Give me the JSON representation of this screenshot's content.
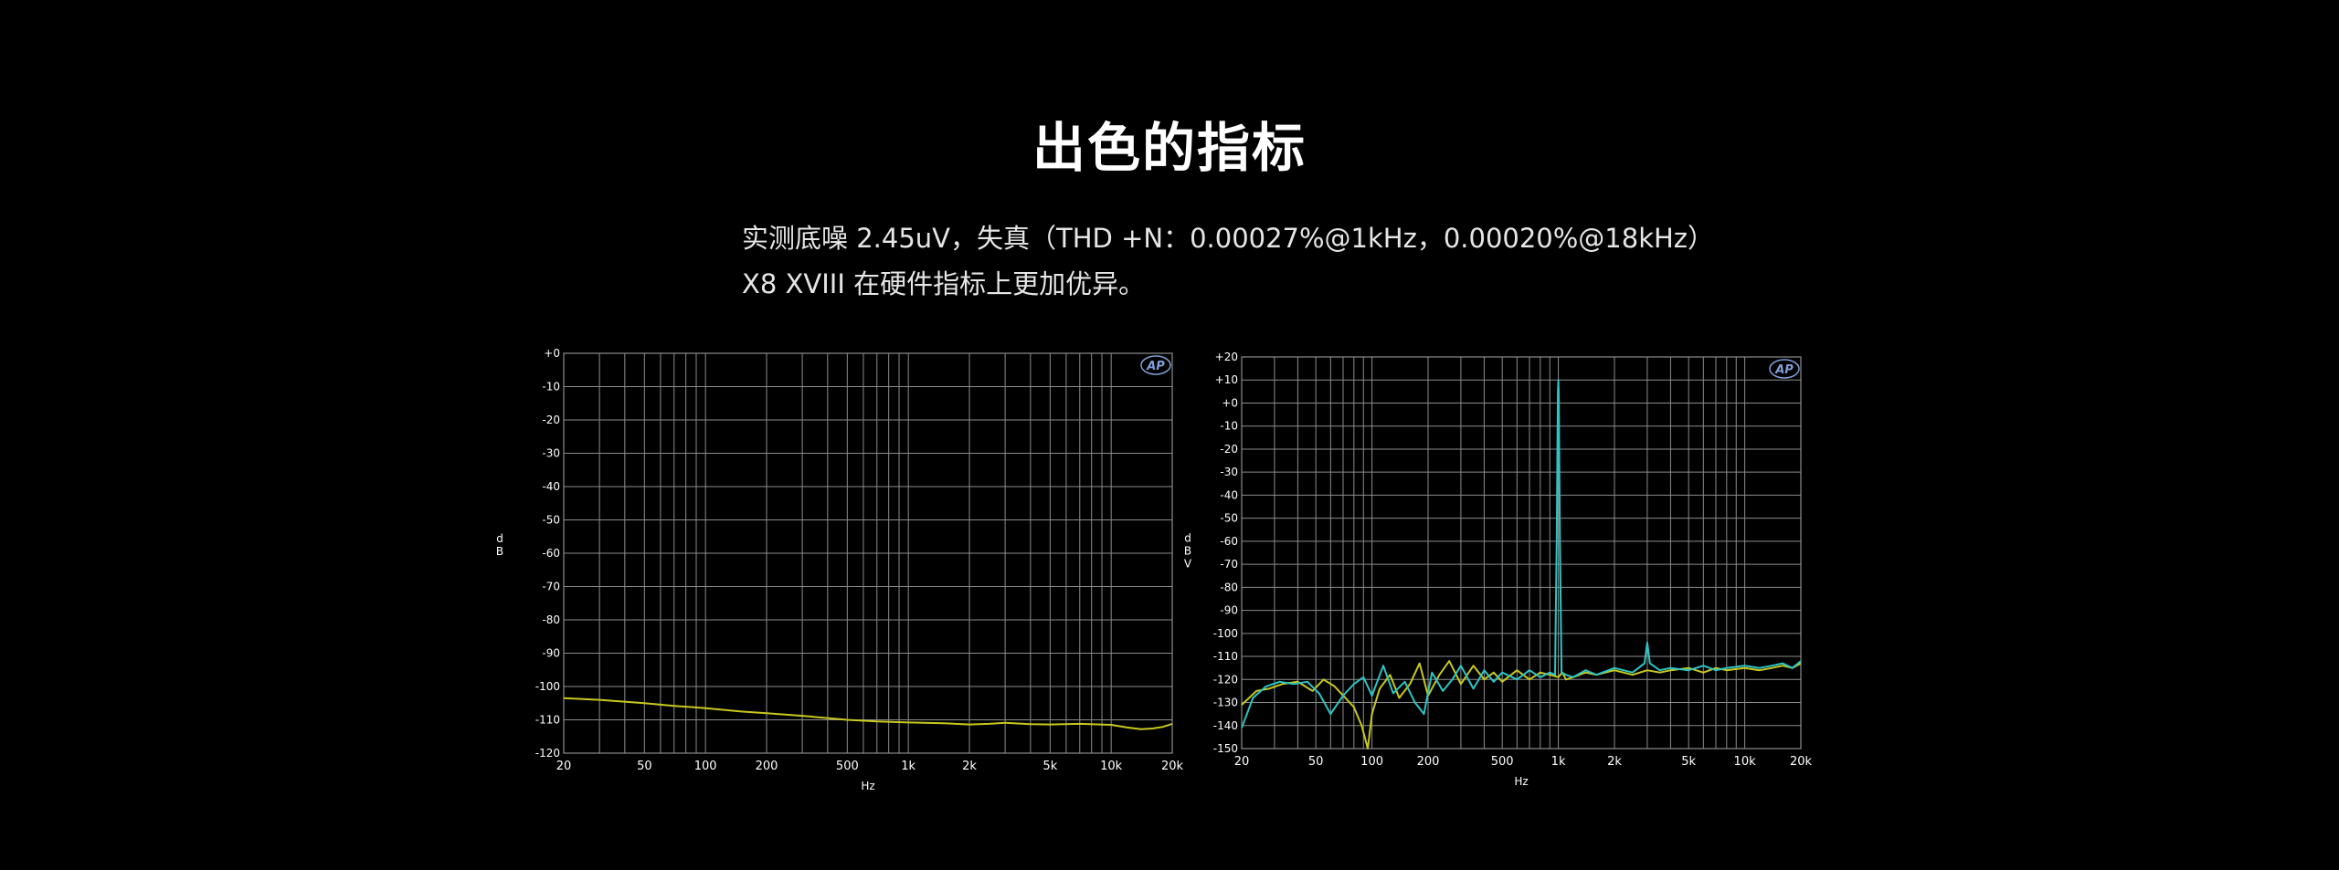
{
  "title": "出色的指标",
  "description": {
    "line1": "实测底噪 2.45uV，失真（THD +N：0.00027%@1kHz，0.00020%@18kHz）",
    "line2": "X8 XVIII 在硬件指标上更加优异。"
  },
  "colors": {
    "background": "#000000",
    "grid": "#8c8c8c",
    "yellow_trace": "#c8c81e",
    "cyan_trace": "#2ec4c4",
    "logo": "#7f9fd6"
  },
  "chart_data": [
    {
      "type": "line",
      "title": "",
      "xlabel": "Hz",
      "ylabel": "dB",
      "x_scale": "log",
      "xlim": [
        20,
        20000
      ],
      "ylim": [
        -120,
        0
      ],
      "grid": true,
      "logo": "AP",
      "xticks": [
        "20",
        "50",
        "100",
        "200",
        "500",
        "1k",
        "2k",
        "5k",
        "10k",
        "20k"
      ],
      "yticks": [
        "+0",
        "-10",
        "-20",
        "-30",
        "-40",
        "-50",
        "-60",
        "-70",
        "-80",
        "-90",
        "-100",
        "-110",
        "-120"
      ],
      "series": [
        {
          "color": "#c8c81e",
          "x": [
            20,
            30,
            50,
            70,
            100,
            150,
            200,
            300,
            500,
            700,
            1000,
            1500,
            2000,
            2500,
            3000,
            4000,
            5000,
            7000,
            10000,
            12000,
            14000,
            16000,
            18000,
            20000
          ],
          "y": [
            -103.5,
            -104,
            -105,
            -105.8,
            -106.5,
            -107.5,
            -108,
            -108.8,
            -110,
            -110.5,
            -110.8,
            -111,
            -111.4,
            -111.2,
            -110.9,
            -111.3,
            -111.4,
            -111.2,
            -111.5,
            -112.3,
            -112.8,
            -112.6,
            -112.1,
            -111.2
          ]
        }
      ]
    },
    {
      "type": "line",
      "title": "",
      "xlabel": "Hz",
      "ylabel": "dBV",
      "x_scale": "log",
      "xlim": [
        20,
        20000
      ],
      "ylim": [
        -150,
        20
      ],
      "grid": true,
      "logo": "AP",
      "xticks": [
        "20",
        "50",
        "100",
        "200",
        "500",
        "1k",
        "2k",
        "5k",
        "10k",
        "20k"
      ],
      "yticks": [
        "+20",
        "+10",
        "+0",
        "-10",
        "-20",
        "-30",
        "-40",
        "-50",
        "-60",
        "-70",
        "-80",
        "-90",
        "-100",
        "-110",
        "-120",
        "-130",
        "-140",
        "-150"
      ],
      "series": [
        {
          "color": "#c8c81e",
          "x": [
            20,
            24,
            28,
            33,
            40,
            48,
            55,
            63,
            72,
            80,
            88,
            95,
            100,
            110,
            125,
            140,
            160,
            180,
            200,
            230,
            260,
            300,
            350,
            400,
            450,
            500,
            600,
            700,
            800,
            900,
            1000,
            1050,
            1100,
            1200,
            1400,
            1600,
            2000,
            2500,
            3000,
            3500,
            4000,
            5000,
            6000,
            7000,
            8000,
            10000,
            12000,
            14000,
            16000,
            18000,
            20000
          ],
          "y": [
            -131,
            -125,
            -124,
            -122,
            -121,
            -125,
            -120,
            -123,
            -128,
            -132,
            -140,
            -150,
            -135,
            -124,
            -118,
            -128,
            -122,
            -113,
            -127,
            -118,
            -112,
            -122,
            -114,
            -120,
            -117,
            -121,
            -116,
            -120,
            -117,
            -118,
            -119,
            -117,
            -120,
            -119,
            -117,
            -118,
            -116,
            -118,
            -116,
            -117,
            -116,
            -115,
            -117,
            -115,
            -116,
            -115,
            -116,
            -115,
            -114,
            -115,
            -113
          ]
        },
        {
          "color": "#2ec4c4",
          "x": [
            20,
            23,
            27,
            32,
            38,
            45,
            52,
            60,
            70,
            80,
            90,
            100,
            115,
            130,
            150,
            170,
            190,
            210,
            240,
            270,
            300,
            350,
            400,
            450,
            500,
            600,
            700,
            800,
            900,
            960,
            980,
            995,
            1000,
            1005,
            1020,
            1040,
            1100,
            1200,
            1400,
            1600,
            2000,
            2500,
            2900,
            3000,
            3100,
            3500,
            4000,
            5000,
            6000,
            7000,
            8000,
            10000,
            12000,
            14000,
            16000,
            18000,
            20000
          ],
          "y": [
            -141,
            -128,
            -123,
            -121,
            -122,
            -121,
            -126,
            -135,
            -127,
            -122,
            -119,
            -127,
            -114,
            -126,
            -121,
            -130,
            -135,
            -117,
            -125,
            -120,
            -114,
            -124,
            -116,
            -121,
            -117,
            -120,
            -116,
            -119,
            -117,
            -118,
            -60,
            5,
            10,
            5,
            -60,
            -117,
            -118,
            -119,
            -116,
            -118,
            -115,
            -117,
            -113,
            -104,
            -113,
            -116,
            -115,
            -116,
            -114,
            -116,
            -115,
            -114,
            -115,
            -114,
            -113,
            -115,
            -112
          ]
        }
      ]
    }
  ]
}
